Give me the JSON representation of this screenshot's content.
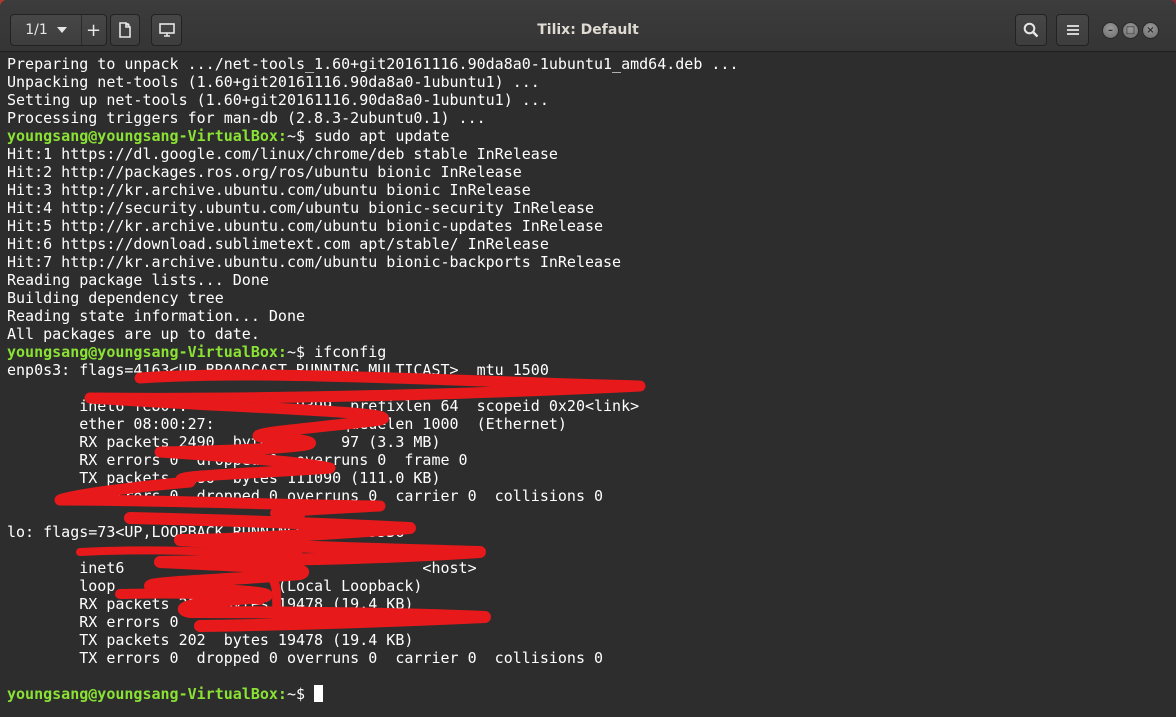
{
  "window": {
    "title": "Tilix: Default",
    "session_counter": "1/1",
    "add_symbol": "+"
  },
  "terminal": {
    "lines": [
      {
        "text": "Preparing to unpack .../net-tools_1.60+git20161116.90da8a0-1ubuntu1_amd64.deb ..."
      },
      {
        "text": "Unpacking net-tools (1.60+git20161116.90da8a0-1ubuntu1) ..."
      },
      {
        "text": "Setting up net-tools (1.60+git20161116.90da8a0-1ubuntu1) ..."
      },
      {
        "text": "Processing triggers for man-db (2.8.3-2ubuntu0.1) ..."
      },
      {
        "user": "youngsang@youngsang-VirtualBox:",
        "path": "~$ ",
        "text": "sudo apt update"
      },
      {
        "text": "Hit:1 https://dl.google.com/linux/chrome/deb stable InRelease"
      },
      {
        "text": "Hit:2 http://packages.ros.org/ros/ubuntu bionic InRelease"
      },
      {
        "text": "Hit:3 http://kr.archive.ubuntu.com/ubuntu bionic InRelease"
      },
      {
        "text": "Hit:4 http://security.ubuntu.com/ubuntu bionic-security InRelease"
      },
      {
        "text": "Hit:5 http://kr.archive.ubuntu.com/ubuntu bionic-updates InRelease"
      },
      {
        "text": "Hit:6 https://download.sublimetext.com apt/stable/ InRelease"
      },
      {
        "text": "Hit:7 http://kr.archive.ubuntu.com/ubuntu bionic-backports InRelease"
      },
      {
        "text": "Reading package lists... Done"
      },
      {
        "text": "Building dependency tree"
      },
      {
        "text": "Reading state information... Done"
      },
      {
        "text": "All packages are up to date."
      },
      {
        "user": "youngsang@youngsang-VirtualBox:",
        "path": "~$ ",
        "text": "ifconfig"
      },
      {
        "text": "enp0s3: flags=4163<UP,BROADCAST,RUNNING,MULTICAST>  mtu 1500"
      },
      {
        "text": ""
      },
      {
        "text": "        inet6 fe80::            9399  prefixlen 64  scopeid 0x20<link>"
      },
      {
        "text": "        ether 08:00:27:              queuelen 1000  (Ethernet)"
      },
      {
        "text": "        RX packets 2490  bytes 3     97 (3.3 MB)"
      },
      {
        "text": "        RX errors 0  dropped 0  overruns 0  frame 0"
      },
      {
        "text": "        TX packets  186  bytes 111090 (111.0 KB)"
      },
      {
        "text": "        TX errors 0  dropped 0 overruns 0  carrier 0  collisions 0"
      },
      {
        "text": ""
      },
      {
        "text": "lo: flags=73<UP,LOOPBACK,RUNNING>  mtu 65536"
      },
      {
        "text": ""
      },
      {
        "text": "        inet6                                 <host>"
      },
      {
        "text": "        loop                  (Local Loopback)"
      },
      {
        "text": "        RX packets 202  bytes 19478 (19.4 KB)"
      },
      {
        "text": "        RX errors 0"
      },
      {
        "text": "        TX packets 202  bytes 19478 (19.4 KB)"
      },
      {
        "text": "        TX errors 0  dropped 0 overruns 0  carrier 0  collisions 0"
      },
      {
        "text": ""
      },
      {
        "user": "youngsang@youngsang-VirtualBox:",
        "path": "~$ ",
        "text": ""
      }
    ]
  },
  "colors": {
    "terminal_bg": "#2d2d2d",
    "prompt_user": "#8ae234",
    "text": "#ffffff",
    "redaction": "#e8191b"
  },
  "icons": [
    "chevron-down-icon",
    "add-terminal-icon",
    "split-terminal-icon",
    "search-icon",
    "hamburger-menu-icon",
    "minimize-icon",
    "maximize-icon",
    "close-icon"
  ]
}
